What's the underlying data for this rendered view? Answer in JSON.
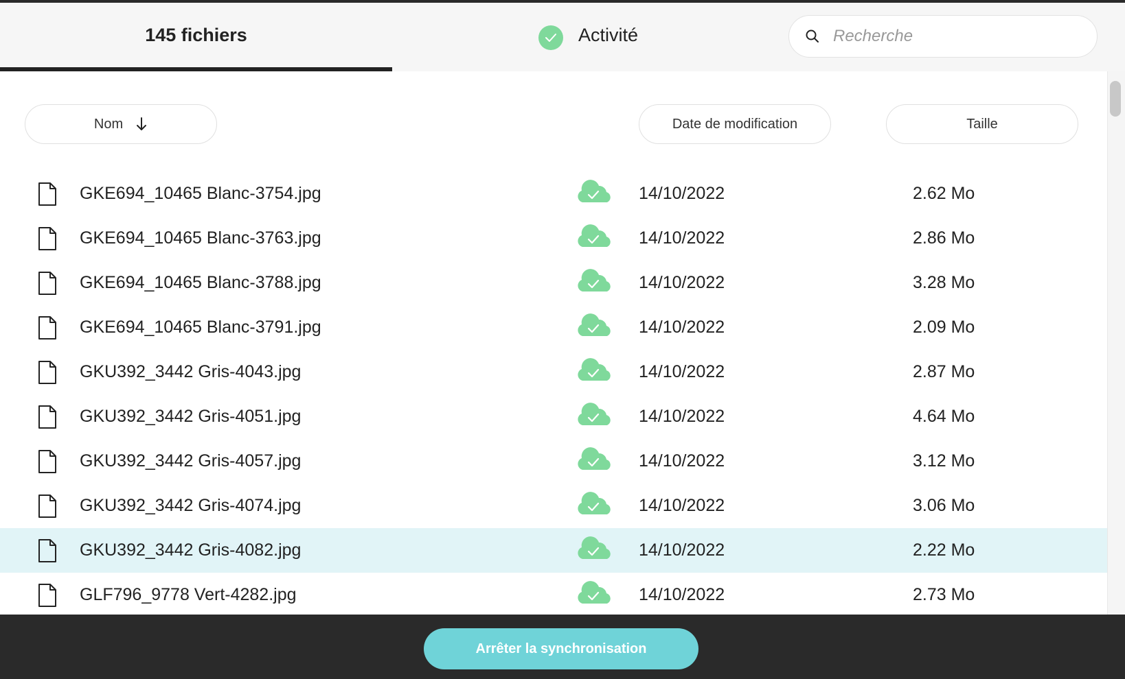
{
  "header": {
    "files_tab_label": "145 fichiers",
    "activity_tab_label": "Activité",
    "search_placeholder": "Recherche",
    "search_value": ""
  },
  "columns": {
    "name": "Nom",
    "date": "Date de modification",
    "size": "Taille",
    "sort_icon": "arrow-down-icon"
  },
  "files": [
    {
      "name": "GKE694_10465 Blanc-3754.jpg",
      "date": "14/10/2022",
      "size": "2.62 Mo",
      "status_icon": "cloud-check-icon",
      "selected": false
    },
    {
      "name": "GKE694_10465 Blanc-3763.jpg",
      "date": "14/10/2022",
      "size": "2.86 Mo",
      "status_icon": "cloud-check-icon",
      "selected": false
    },
    {
      "name": "GKE694_10465 Blanc-3788.jpg",
      "date": "14/10/2022",
      "size": "3.28 Mo",
      "status_icon": "cloud-check-icon",
      "selected": false
    },
    {
      "name": "GKE694_10465 Blanc-3791.jpg",
      "date": "14/10/2022",
      "size": "2.09 Mo",
      "status_icon": "cloud-check-icon",
      "selected": false
    },
    {
      "name": "GKU392_3442 Gris-4043.jpg",
      "date": "14/10/2022",
      "size": "2.87 Mo",
      "status_icon": "cloud-check-icon",
      "selected": false
    },
    {
      "name": "GKU392_3442 Gris-4051.jpg",
      "date": "14/10/2022",
      "size": "4.64 Mo",
      "status_icon": "cloud-check-icon",
      "selected": false
    },
    {
      "name": "GKU392_3442 Gris-4057.jpg",
      "date": "14/10/2022",
      "size": "3.12 Mo",
      "status_icon": "cloud-check-icon",
      "selected": false
    },
    {
      "name": "GKU392_3442 Gris-4074.jpg",
      "date": "14/10/2022",
      "size": "3.06 Mo",
      "status_icon": "cloud-check-icon",
      "selected": false
    },
    {
      "name": "GKU392_3442 Gris-4082.jpg",
      "date": "14/10/2022",
      "size": "2.22 Mo",
      "status_icon": "cloud-check-icon",
      "selected": true
    },
    {
      "name": "GLF796_9778 Vert-4282.jpg",
      "date": "14/10/2022",
      "size": "2.73 Mo",
      "status_icon": "cloud-check-icon",
      "selected": false
    }
  ],
  "footer": {
    "stop_sync_label": "Arrêter la synchronisation"
  },
  "colors": {
    "sync_green": "#7fd99b",
    "selected_row": "#e1f4f7",
    "button_teal": "#6fd3d8",
    "footer_bg": "#2a2a2a"
  }
}
